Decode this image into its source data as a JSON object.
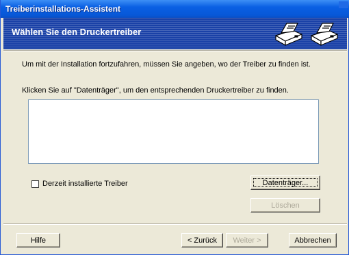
{
  "window": {
    "title": "Treiberinstallations-Assistent"
  },
  "banner": {
    "heading": "Wählen Sie den Druckertreiber",
    "icon_names": [
      "printer-icon",
      "printer-icon"
    ]
  },
  "content": {
    "instruction": "Um mit der Installation fortzufahren, müssen Sie angeben, wo der Treiber zu finden ist.",
    "prompt": "Klicken Sie auf \"Datenträger\", um den entsprechenden Druckertreiber zu finden.",
    "driver_list": [],
    "checkbox_label": "Derzeit installierte Treiber",
    "checkbox_checked": false
  },
  "buttons": {
    "disk": "Datenträger...",
    "delete": "Löschen",
    "help": "Hilfe",
    "back": "< Zurück",
    "next": "Weiter >",
    "cancel": "Abbrechen"
  },
  "colors": {
    "titlebar": "#0a5fe3",
    "banner": "#1a41a7",
    "face": "#ece9d8",
    "disabled_text": "#aca899"
  }
}
